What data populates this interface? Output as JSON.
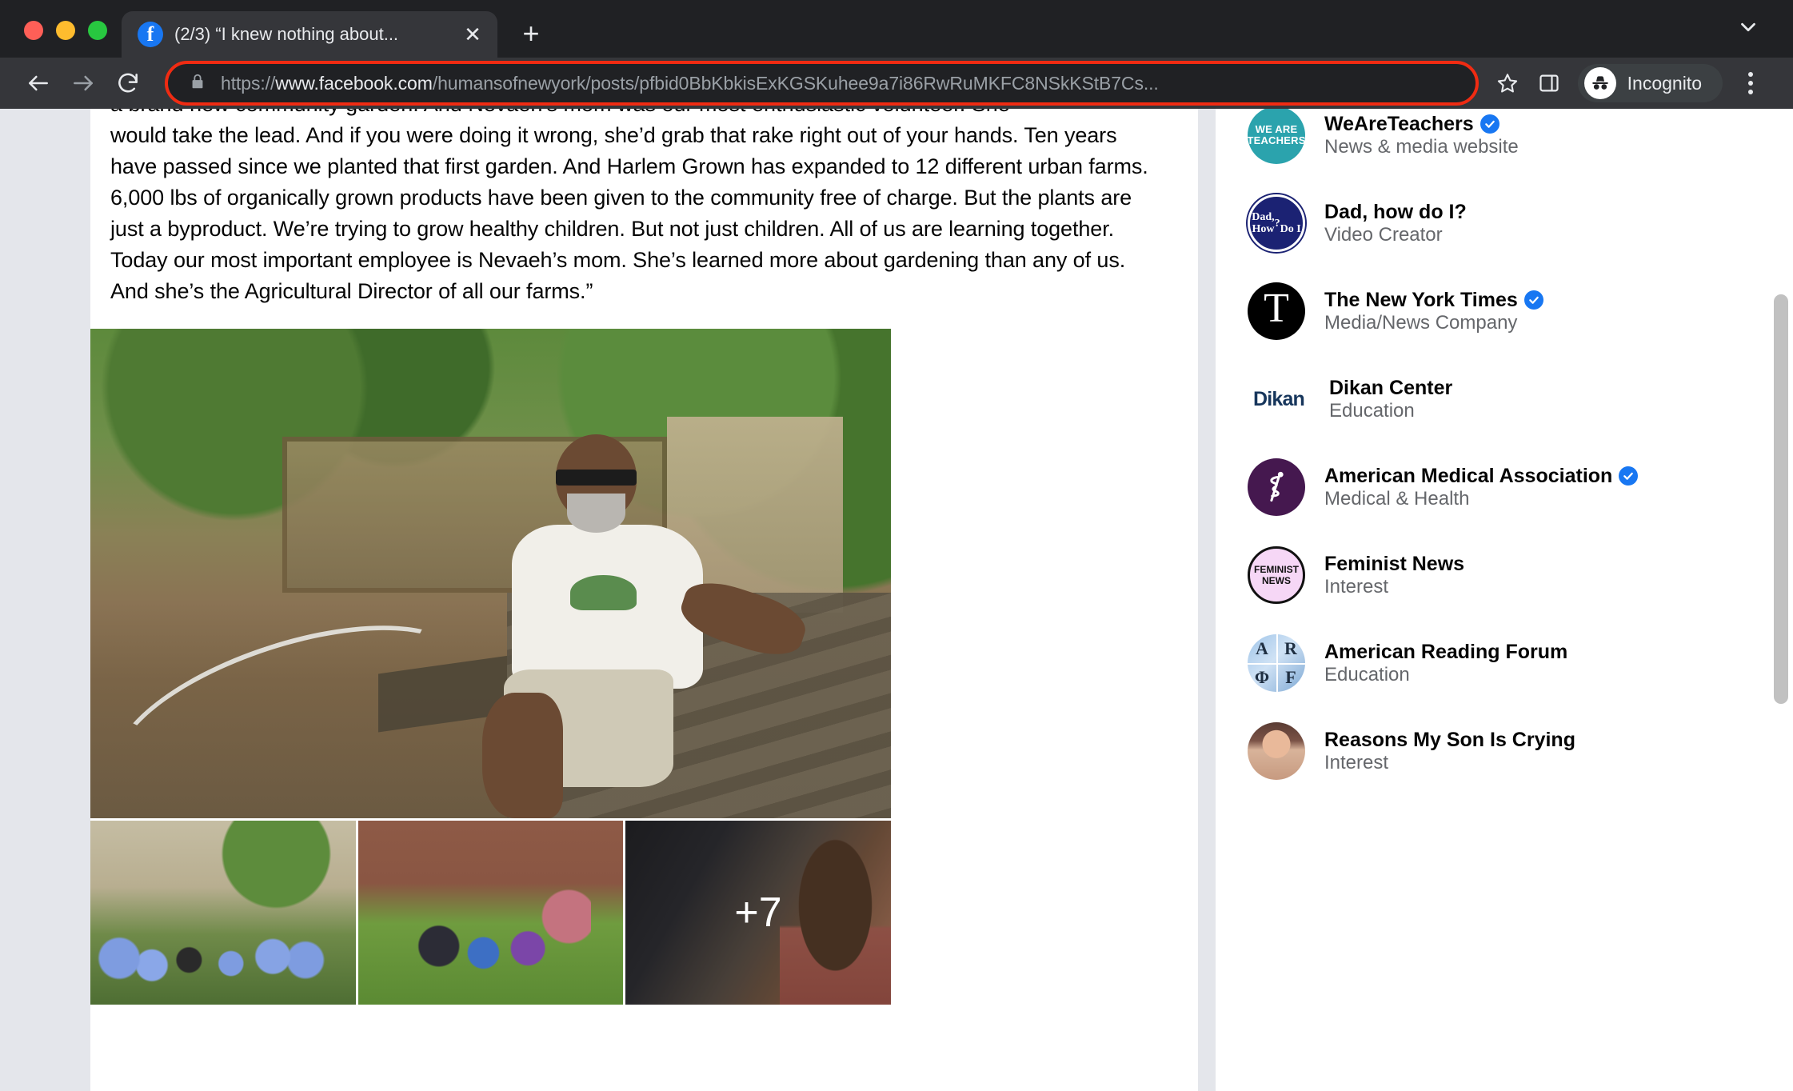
{
  "browser": {
    "tab": {
      "title": "(2/3) “I knew nothing about...",
      "favicon": "facebook-icon",
      "close_label": "✕"
    },
    "new_tab_label": "+",
    "tab_list_chevron": "chevron-down-icon",
    "nav": {
      "back": "←",
      "forward": "→",
      "reload": "⟳"
    },
    "omnibox": {
      "scheme": "https://",
      "host": "www.facebook.com",
      "path": "/humansofnewyork/posts/pfbid0BbKbkisExKGSKuhee9a7i86RwRuMKFC8NSkKStB7Cs...",
      "full_url": "https://www.facebook.com/humansofnewyork/posts/pfbid0BbKbkisExKGSKuhee9a7i86RwRuMKFC8NSkKStB7Cs...",
      "lock_icon": "lock-icon",
      "highlight_color": "#f02b12"
    },
    "actions": {
      "bookmark": "star-icon",
      "side_panel": "side-panel-icon",
      "profile_label": "Incognito",
      "profile_icon": "incognito-hat-icon",
      "menu": "kebab-menu-icon"
    }
  },
  "post": {
    "clipped_top_line": "a brand new community garden. And Nevaeh's mom was our most enthusiastic volunteer. She",
    "body": "would take the lead. And if you were doing it wrong, she’d grab that rake right out of your hands. Ten years have passed since we planted that first garden. And Harlem Grown has expanded to 12 different urban farms. 6,000 lbs of organically grown products have been given to the community free of charge. But the plants are just a byproduct. We’re trying to grow healthy children. But not just children. All of us are learning together. Today our most important employee is Nevaeh’s mom. She’s learned more about gardening than any of us. And she’s the Agricultural Director of all our farms.”",
    "gallery": {
      "main_photo_alt": "Man in Harlem Grown t-shirt sitting on a wooden bench in a community garden",
      "thumbnails": [
        {
          "alt": "Group of volunteers in blue t-shirts working in a garden"
        },
        {
          "alt": "Children standing on grass in front of a brick building"
        },
        {
          "alt": "Close-up of children planting"
        }
      ],
      "more_count_label": "+7"
    }
  },
  "sidebar": {
    "items": [
      {
        "name": "WeAreTeachers",
        "category": "News & media website",
        "verified": true,
        "avatar": "we-are-teachers-logo",
        "avatar_text": "WE ARE\nTEACHERS",
        "avatar_color": "#2ba3ad"
      },
      {
        "name": "Dad, how do I?",
        "category": "Video Creator",
        "verified": false,
        "avatar": "dad-how-do-i-logo",
        "avatar_text": "Dad,\nHow ?\nDo I",
        "avatar_color": "#1b2273"
      },
      {
        "name": "The New York Times",
        "category": "Media/News Company",
        "verified": true,
        "avatar": "new-york-times-logo",
        "avatar_text": "T",
        "avatar_color": "#000000"
      },
      {
        "name": "Dikan Center",
        "category": "Education",
        "verified": false,
        "avatar": "dikan-logo",
        "avatar_text": "Dikan",
        "avatar_color": "#17365c"
      },
      {
        "name": "American Medical Association",
        "category": "Medical & Health",
        "verified": true,
        "avatar": "american-medical-association-logo",
        "avatar_text": "⚕",
        "avatar_color": "#45184f"
      },
      {
        "name": "Feminist News",
        "category": "Interest",
        "verified": false,
        "avatar": "feminist-news-logo",
        "avatar_text": "FEMINIST\nNEWS",
        "avatar_color": "#f6d7f6"
      },
      {
        "name": "American Reading Forum",
        "category": "Education",
        "verified": false,
        "avatar": "american-reading-forum-logo",
        "avatar_text": "A R F",
        "avatar_color": "#9fc4e8"
      },
      {
        "name": "Reasons My Son Is Crying",
        "category": "Interest",
        "verified": false,
        "avatar": "reasons-my-son-is-crying-photo",
        "avatar_text": "",
        "avatar_color": "#7a5246"
      }
    ]
  }
}
